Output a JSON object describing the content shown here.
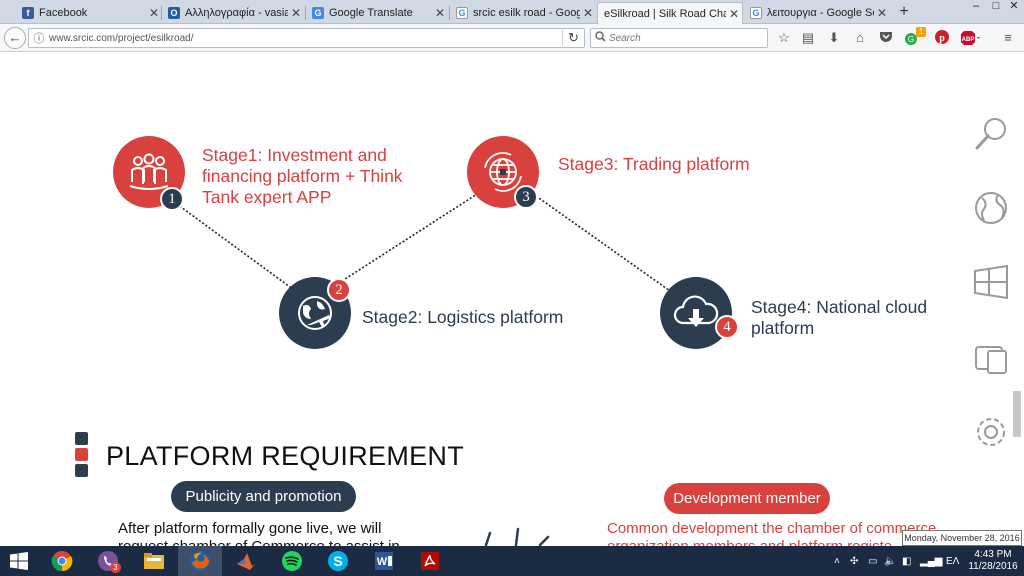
{
  "tabs": [
    {
      "title": "Facebook",
      "favicon": "facebook-icon"
    },
    {
      "title": "Αλληλογραφία - vasia r...",
      "favicon": "outlook-icon"
    },
    {
      "title": "Google Translate",
      "favicon": "google-translate-icon"
    },
    {
      "title": "srcic esilk road - Googl...",
      "favicon": "google-icon"
    },
    {
      "title": "eSilkroad | Silk Road Cham...",
      "favicon": "page-icon",
      "active": true
    },
    {
      "title": "λειτουργια - Google Se...",
      "favicon": "google-icon"
    }
  ],
  "newtab_label": "+",
  "window_controls": {
    "minimize": "–",
    "maximize": "□",
    "close": "✕"
  },
  "nav": {
    "url": "www.srcic.com/project/esilkroad/",
    "search_placeholder": "Search",
    "hangouts_badge": "1"
  },
  "stages": [
    {
      "number": "1",
      "label_lines": [
        "Stage1: Investment and",
        "financing platform + Think",
        "Tank expert APP"
      ],
      "icon": "people-group-icon"
    },
    {
      "number": "2",
      "label_lines": [
        "Stage2: Logistics platform"
      ],
      "icon": "globe-plane-icon"
    },
    {
      "number": "3",
      "label_lines": [
        "Stage3: Trading platform"
      ],
      "icon": "globe-grid-icon"
    },
    {
      "number": "4",
      "label_lines": [
        "Stage4: National cloud",
        "platform"
      ],
      "icon": "cloud-download-icon"
    }
  ],
  "requirement": {
    "title": "PLATFORM REQUIREMENT",
    "left_pill": "Publicity and promotion",
    "right_pill": "Development member",
    "left_text": [
      "After platform formally gone live, we will",
      "request chamber of Commerce to assist in"
    ],
    "right_text": [
      "Common development the chamber of commerce",
      "organization members and platform registe..."
    ]
  },
  "side_icons": [
    "search-icon",
    "globe-icon",
    "windows-icon",
    "devices-icon",
    "settings-icon"
  ],
  "colors": {
    "accent_red": "#d9413f",
    "navy": "#2c3d50",
    "taskbar": "#1b2b44"
  },
  "taskbar": {
    "apps": [
      "start-icon",
      "chrome-icon",
      "viber-icon",
      "file-explorer-icon",
      "firefox-icon",
      "matlab-icon",
      "spotify-icon",
      "skype-icon",
      "word-icon",
      "acrobat-icon"
    ],
    "viber_badge": "3",
    "language": "ΕΛ",
    "time": "4:43 PM",
    "date": "11/28/2016",
    "tooltip": "Monday, November 28, 2016"
  }
}
